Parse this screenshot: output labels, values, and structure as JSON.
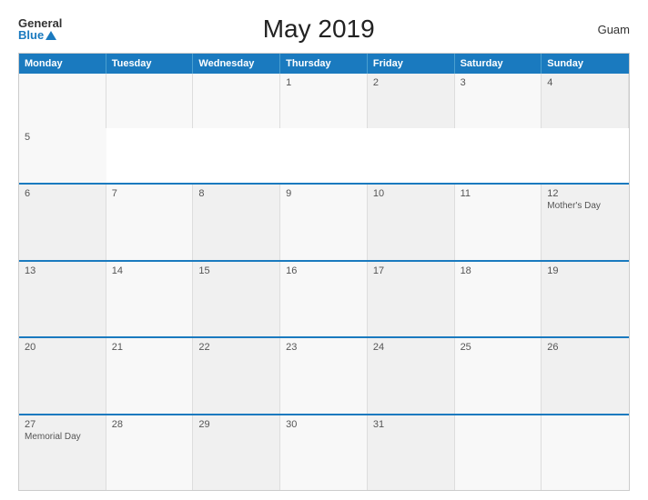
{
  "header": {
    "title": "May 2019",
    "region": "Guam",
    "logo_general": "General",
    "logo_blue": "Blue"
  },
  "calendar": {
    "days_of_week": [
      "Monday",
      "Tuesday",
      "Wednesday",
      "Thursday",
      "Friday",
      "Saturday",
      "Sunday"
    ],
    "weeks": [
      [
        {
          "day": "",
          "event": ""
        },
        {
          "day": "",
          "event": ""
        },
        {
          "day": "",
          "event": ""
        },
        {
          "day": "1",
          "event": ""
        },
        {
          "day": "2",
          "event": ""
        },
        {
          "day": "3",
          "event": ""
        },
        {
          "day": "4",
          "event": ""
        },
        {
          "day": "5",
          "event": ""
        }
      ],
      [
        {
          "day": "6",
          "event": ""
        },
        {
          "day": "7",
          "event": ""
        },
        {
          "day": "8",
          "event": ""
        },
        {
          "day": "9",
          "event": ""
        },
        {
          "day": "10",
          "event": ""
        },
        {
          "day": "11",
          "event": ""
        },
        {
          "day": "12",
          "event": "Mother's Day"
        }
      ],
      [
        {
          "day": "13",
          "event": ""
        },
        {
          "day": "14",
          "event": ""
        },
        {
          "day": "15",
          "event": ""
        },
        {
          "day": "16",
          "event": ""
        },
        {
          "day": "17",
          "event": ""
        },
        {
          "day": "18",
          "event": ""
        },
        {
          "day": "19",
          "event": ""
        }
      ],
      [
        {
          "day": "20",
          "event": ""
        },
        {
          "day": "21",
          "event": ""
        },
        {
          "day": "22",
          "event": ""
        },
        {
          "day": "23",
          "event": ""
        },
        {
          "day": "24",
          "event": ""
        },
        {
          "day": "25",
          "event": ""
        },
        {
          "day": "26",
          "event": ""
        }
      ],
      [
        {
          "day": "27",
          "event": "Memorial Day"
        },
        {
          "day": "28",
          "event": ""
        },
        {
          "day": "29",
          "event": ""
        },
        {
          "day": "30",
          "event": ""
        },
        {
          "day": "31",
          "event": ""
        },
        {
          "day": "",
          "event": ""
        },
        {
          "day": "",
          "event": ""
        }
      ]
    ]
  }
}
